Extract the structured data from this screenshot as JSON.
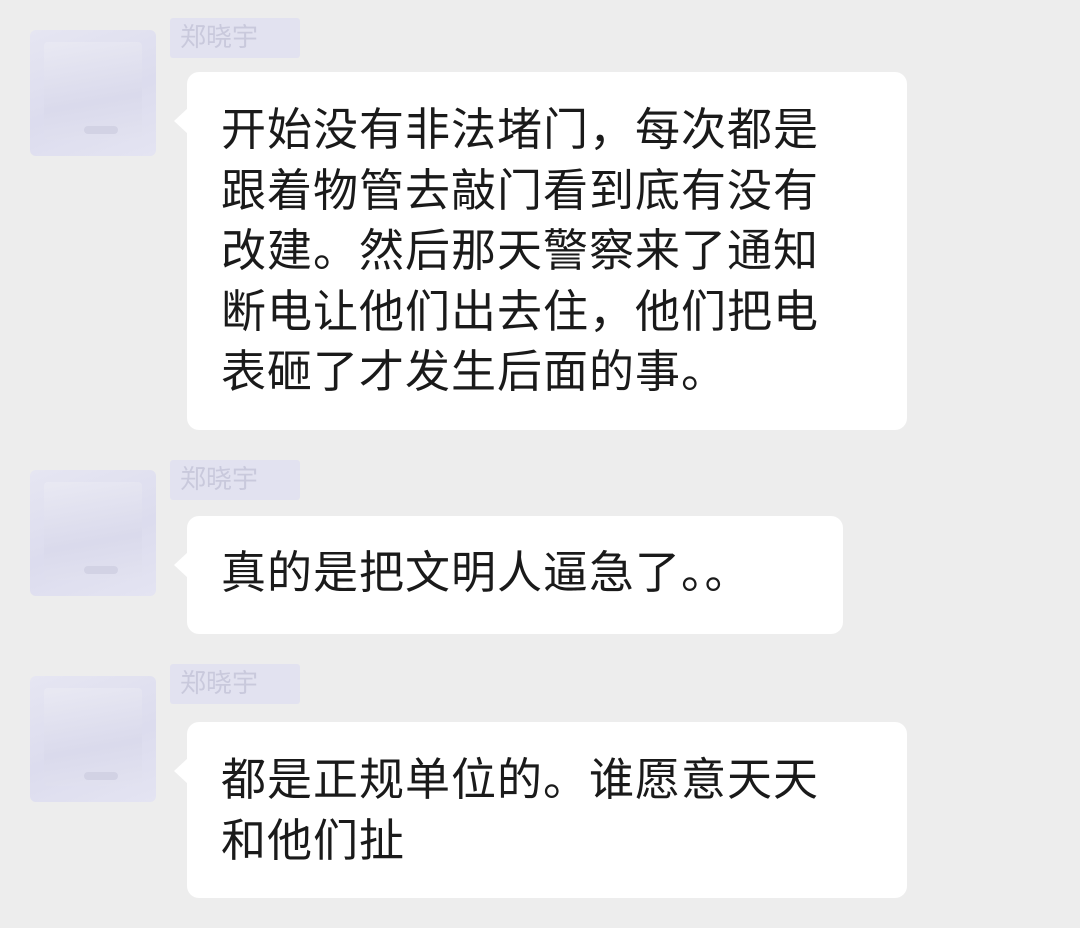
{
  "messages": [
    {
      "sender_name": "郑晓宇",
      "text": "开始没有非法堵门，每次都是\n跟着物管去敲门看到底有没有\n改建。然后那天警察来了通知\n断电让他们出去住，他们把电\n表砸了才发生后面的事。"
    },
    {
      "sender_name": "郑晓宇",
      "text": "真的是把文明人逼急了。。"
    },
    {
      "sender_name": "郑晓宇",
      "text": "都是正规单位的。谁愿意天天\n和他们扯"
    }
  ],
  "colors": {
    "background": "#ededed",
    "bubble": "#ffffff",
    "text": "#1a1a1a",
    "avatar_redaction": "#dcdcee"
  },
  "icons": {
    "avatar": "blurred-avatar-icon"
  }
}
